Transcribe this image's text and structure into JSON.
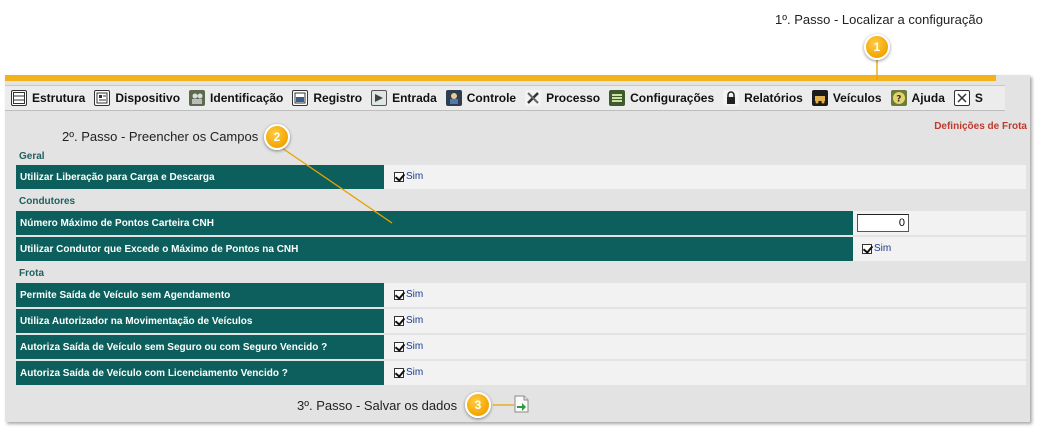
{
  "steps": {
    "step1_text": "1º. Passo - Localizar a configuração",
    "step2_text": "2º. Passo - Preencher os Campos",
    "step3_text": "3º. Passo - Salvar os dados",
    "badge1": "1",
    "badge2": "2",
    "badge3": "3"
  },
  "menu": {
    "items": [
      {
        "label": "Estrutura",
        "icon": "table-icon"
      },
      {
        "label": "Dispositivo",
        "icon": "device-icon"
      },
      {
        "label": "Identificação",
        "icon": "people-icon"
      },
      {
        "label": "Registro",
        "icon": "register-icon"
      },
      {
        "label": "Entrada",
        "icon": "entry-icon"
      },
      {
        "label": "Controle",
        "icon": "control-icon"
      },
      {
        "label": "Processo",
        "icon": "tools-icon"
      },
      {
        "label": "Configurações",
        "icon": "settings-icon"
      },
      {
        "label": "Relatórios",
        "icon": "lock-icon"
      },
      {
        "label": "Veículos",
        "icon": "vehicle-icon"
      },
      {
        "label": "Ajuda",
        "icon": "help-icon"
      },
      {
        "label": "S",
        "icon": "exit-icon"
      }
    ]
  },
  "page_title": "Definições de Frota",
  "sections": {
    "geral": "Geral",
    "condutores": "Condutores",
    "frota": "Frota"
  },
  "fields": {
    "liberacao_carga": {
      "label": "Utilizar Liberação para Carga e Descarga",
      "check_label": "Sim",
      "checked": true
    },
    "max_pontos": {
      "label": "Número Máximo de Pontos Carteira CNH",
      "value": "0"
    },
    "condutor_excede": {
      "label": "Utilizar Condutor que Excede o Máximo de Pontos na CNH",
      "check_label": "Sim",
      "checked": true
    },
    "saida_sem_agendamento": {
      "label": "Permite Saída de Veículo sem Agendamento",
      "check_label": "Sim",
      "checked": true
    },
    "autorizador": {
      "label": "Utiliza Autorizador na Movimentação de Veículos",
      "check_label": "Sim",
      "checked": true
    },
    "sem_seguro": {
      "label": "Autoriza Saída de Veículo sem Seguro ou com Seguro Vencido ?",
      "check_label": "Sim",
      "checked": true
    },
    "licenciamento": {
      "label": "Autoriza Saída de Veículo com Licenciamento Vencido ?",
      "check_label": "Sim",
      "checked": true
    }
  },
  "colors": {
    "accent": "#f3b21c",
    "label_bg": "#0c5f5c",
    "section_text": "#1f5f5f",
    "title_red": "#c0392b"
  }
}
